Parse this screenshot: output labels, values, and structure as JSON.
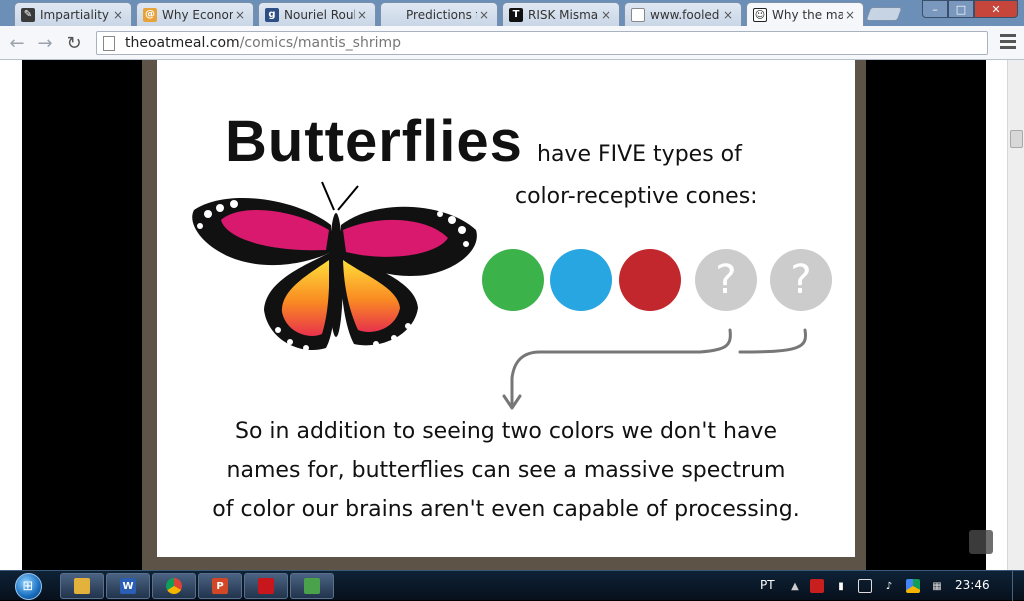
{
  "tabs": [
    {
      "title": "Impartiality (",
      "icon": "quill-icon",
      "color": "#3a3a3a"
    },
    {
      "title": "Why Econon",
      "icon": "at-sign-icon",
      "color": "#e8a23a"
    },
    {
      "title": "Nouriel Roub",
      "icon": "g-logo-icon",
      "color": "#2d4f84"
    },
    {
      "title": "Predictions f",
      "icon": "blank-icon",
      "color": "#cccccc"
    },
    {
      "title": "RISK Misman",
      "icon": "nyt-icon",
      "color": "#111111"
    },
    {
      "title": "www.fooled",
      "icon": "page-icon",
      "color": "#ffffff"
    },
    {
      "title": "Why the mar",
      "icon": "oatmeal-icon",
      "color": "#222222"
    }
  ],
  "tab_close": "×",
  "window_controls": {
    "minimize": "–",
    "maximize": "□",
    "close": "✕"
  },
  "toolbar": {
    "back": "←",
    "forward": "→",
    "reload": "↻",
    "url_host": "theoatmeal.com",
    "url_path": "/comics/mantis_shrimp"
  },
  "comic": {
    "title": "Butterflies",
    "subtitle_line1": "have FIVE types of",
    "subtitle_line2": "color-receptive cones:",
    "cones": [
      {
        "color": "#3cb34a",
        "label": ""
      },
      {
        "color": "#27a6e1",
        "label": ""
      },
      {
        "color": "#c1272d",
        "label": ""
      },
      {
        "color": "#cccccc",
        "label": "?"
      },
      {
        "color": "#cccccc",
        "label": "?"
      }
    ],
    "body_line1": "So in addition to seeing two colors we don't have",
    "body_line2": "names for, butterflies can see a massive spectrum",
    "body_line3": "of color our brains aren't even capable of processing."
  },
  "taskbar": {
    "apps": [
      {
        "icon": "explorer-icon",
        "label": "",
        "color": "#e3b23c"
      },
      {
        "icon": "word-icon",
        "label": "W",
        "color": "#2b5fb4"
      },
      {
        "icon": "chrome-icon",
        "label": "",
        "color": "#e0b02a"
      },
      {
        "icon": "powerpoint-icon",
        "label": "P",
        "color": "#d24726"
      },
      {
        "icon": "acrobat-icon",
        "label": "",
        "color": "#c8161d"
      },
      {
        "icon": "messenger-icon",
        "label": "",
        "color": "#4aa34a"
      }
    ],
    "language": "PT",
    "clock": "23:46"
  }
}
